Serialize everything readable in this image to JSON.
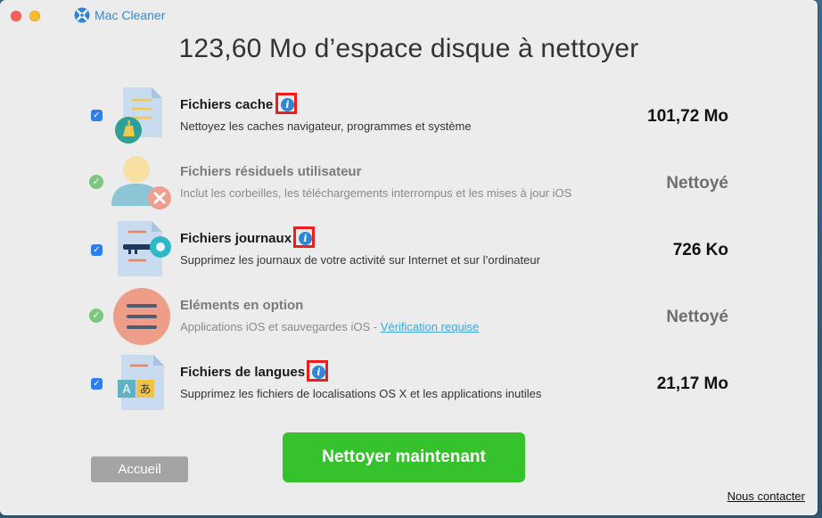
{
  "app": {
    "title": "Mac Cleaner"
  },
  "headline": "123,60 Mo d’espace disque à nettoyer",
  "rows": [
    {
      "title": "Fichiers cache",
      "description": "Nettoyez les caches navigateur, programmes et système",
      "size": "101,72 Mo",
      "state": "checked",
      "icon": "cache-files-icon"
    },
    {
      "title": "Fichiers résiduels utilisateur",
      "description": "Inclut les corbeilles, les téléchargements interrompus et les mises à jour iOS",
      "size": "Nettoyé",
      "state": "cleaned",
      "icon": "user-residual-icon"
    },
    {
      "title": "Fichiers journaux",
      "description": "Supprimez les journaux de votre activité sur Internet et sur l’ordinateur",
      "size": "726 Ko",
      "state": "checked",
      "icon": "log-files-icon"
    },
    {
      "title": "Eléments en option",
      "description": "Applications iOS et sauvegardes iOS - ",
      "link": "Vérification requise",
      "size": "Nettoyé",
      "state": "cleaned",
      "icon": "optional-items-icon"
    },
    {
      "title": "Fichiers de langues",
      "description": "Supprimez les fichiers de localisations OS X et les applications inutiles",
      "size": "21,17 Mo",
      "state": "checked",
      "icon": "language-files-icon"
    }
  ],
  "buttons": {
    "home": "Accueil",
    "clean": "Nettoyer maintenant"
  },
  "footer": {
    "contact": "Nous contacter"
  },
  "colors": {
    "accent_blue": "#2f86d6",
    "clean_green": "#35c22c",
    "checkbox_blue": "#2d7ff0",
    "highlight_red": "#ee1c1c"
  }
}
